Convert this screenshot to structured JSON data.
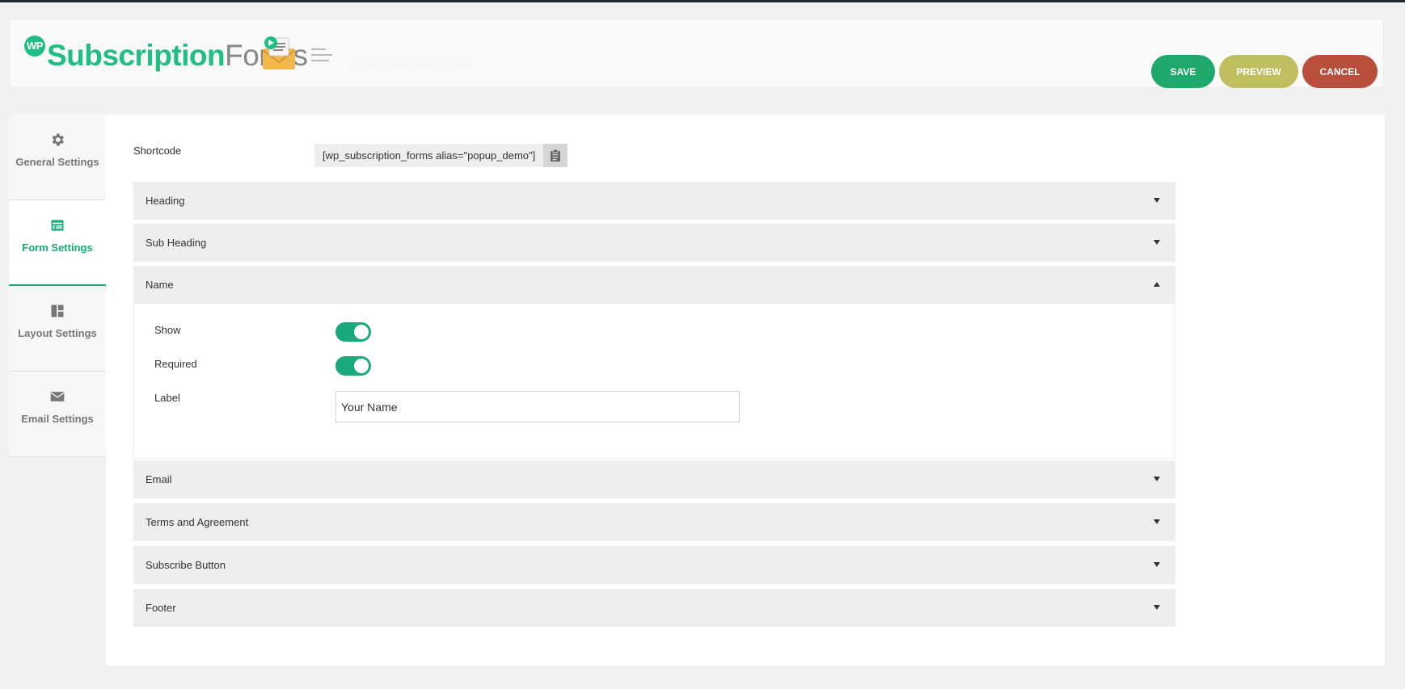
{
  "app": {
    "logo_badge": "WP",
    "logo_brand": "Subscription",
    "logo_suffix": "Forms",
    "ghost_note": "Lorem ipsum dolor sit amet"
  },
  "toolbar": {
    "save_label": "SAVE",
    "preview_label": "PREVIEW",
    "cancel_label": "CANCEL"
  },
  "colors": {
    "accent": "#1aa97a",
    "save": "#1ea86b",
    "preview": "#bfbf5f",
    "cancel": "#b94e3c"
  },
  "sidebar": {
    "items": [
      {
        "label": "General Settings",
        "icon": "gear-icon",
        "active": false
      },
      {
        "label": "Form Settings",
        "icon": "form-icon",
        "active": true
      },
      {
        "label": "Layout Settings",
        "icon": "layout-icon",
        "active": false
      },
      {
        "label": "Email Settings",
        "icon": "envelope-icon",
        "active": false
      }
    ]
  },
  "shortcode": {
    "label": "Shortcode",
    "value": "[wp_subscription_forms alias=\"popup_demo\"]"
  },
  "sections": [
    {
      "title": "Heading",
      "expanded": false
    },
    {
      "title": "Sub Heading",
      "expanded": false
    },
    {
      "title": "Name",
      "expanded": true
    },
    {
      "title": "Email",
      "expanded": false
    },
    {
      "title": "Terms and Agreement",
      "expanded": false
    },
    {
      "title": "Subscribe Button",
      "expanded": false
    },
    {
      "title": "Footer",
      "expanded": false
    }
  ],
  "name_fields": {
    "show_label": "Show",
    "show_on": true,
    "required_label": "Required",
    "required_on": true,
    "label_label": "Label",
    "label_value": "Your Name"
  }
}
